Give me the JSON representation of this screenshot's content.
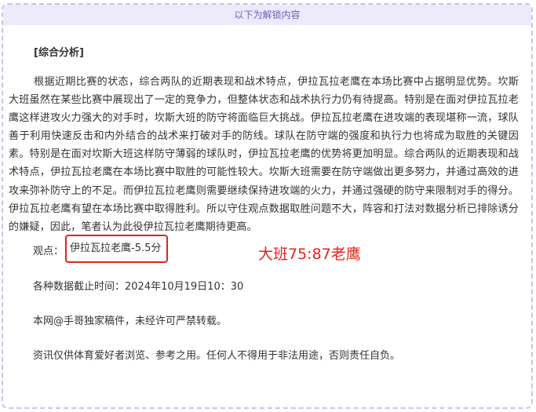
{
  "banner": {
    "text": "以下为解锁内容"
  },
  "article": {
    "section_title": "[综合分析]",
    "paragraph": "根据近期比赛的状态，综合两队的近期表现和战术特点，伊拉瓦拉老鹰在本场比赛中占据明显优势。坎斯大班虽然在某些比赛中展现出了一定的竞争力，但整体状态和战术执行力仍有待提高。特别是在面对伊拉瓦拉老鹰这样进攻火力强大的对手时，坎斯大班的防守将面临巨大挑战。伊拉瓦拉老鹰在进攻端的表现堪称一流，球队善于利用快速反击和内外结合的战术来打破对手的防线。球队在防守端的强度和执行力也将成为取胜的关键因素。特别是在面对坎斯大班这样防守薄弱的球队时，伊拉瓦拉老鹰的优势将更加明显。综合两队的近期表现和战术特点，伊拉瓦拉老鹰在本场比赛中取胜的可能性较大。坎斯大班需要在防守端做出更多努力，并通过高效的进攻来弥补防守上的不足。而伊拉瓦拉老鹰则需要继续保持进攻端的火力，并通过强硬的防守来限制对手的得分。伊拉瓦拉老鹰有望在本场比赛中取得胜利。所以守住观点数据取胜问题不大，阵容和打法对数据分析已排除诱分的嫌疑，因此，笔者认为此役伊拉瓦拉老鹰期待更高。",
    "view_label": "观点：",
    "view_value": "伊拉瓦拉老鹰-5.5分",
    "annotation": "大班75:87老鹰",
    "cutoff": "各种数据截止时间：2024年10月19日10：30",
    "copyright": "本网@手哥独家稿件，未经许可严禁转载。",
    "disclaimer": "资讯仅供体育爱好者浏览、参考之用。任何人不得用于非法用途，否则责任自负。"
  },
  "colors": {
    "frame_border": "#c9c3f0",
    "banner_bg": "#edeafc",
    "banner_text": "#6b62b5",
    "highlight_red": "#e0241c"
  }
}
